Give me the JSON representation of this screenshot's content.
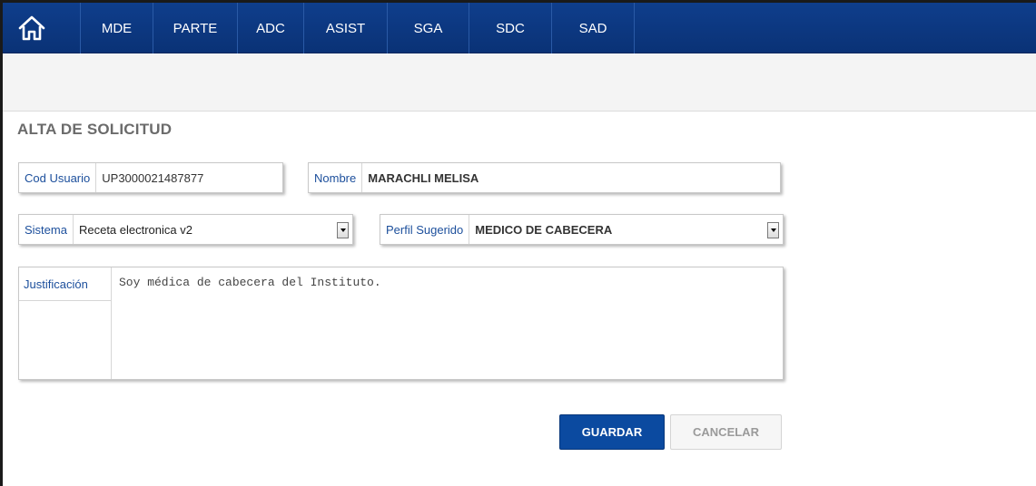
{
  "nav": {
    "home_icon": "home-icon",
    "items": [
      {
        "label": "MDE"
      },
      {
        "label": "PARTE"
      },
      {
        "label": "ADC"
      },
      {
        "label": "ASIST"
      },
      {
        "label": "SGA"
      },
      {
        "label": "SDC"
      },
      {
        "label": "SAD"
      }
    ]
  },
  "page": {
    "title": "ALTA DE SOLICITUD"
  },
  "form": {
    "cod_usuario": {
      "label": "Cod Usuario",
      "value": "UP3000021487877"
    },
    "nombre": {
      "label": "Nombre",
      "value": "MARACHLI MELISA"
    },
    "sistema": {
      "label": "Sistema",
      "value": "Receta electronica v2"
    },
    "perfil": {
      "label": "Perfil Sugerido",
      "value": "MEDICO DE CABECERA"
    },
    "justificacion": {
      "label": "Justificación",
      "value": "Soy médica de cabecera del Instituto."
    }
  },
  "actions": {
    "save_label": "GUARDAR",
    "cancel_label": "CANCELAR"
  },
  "colors": {
    "navbar": "#0f3e8c",
    "primary_button": "#0b4aa0",
    "label_text": "#1c4f9c"
  }
}
